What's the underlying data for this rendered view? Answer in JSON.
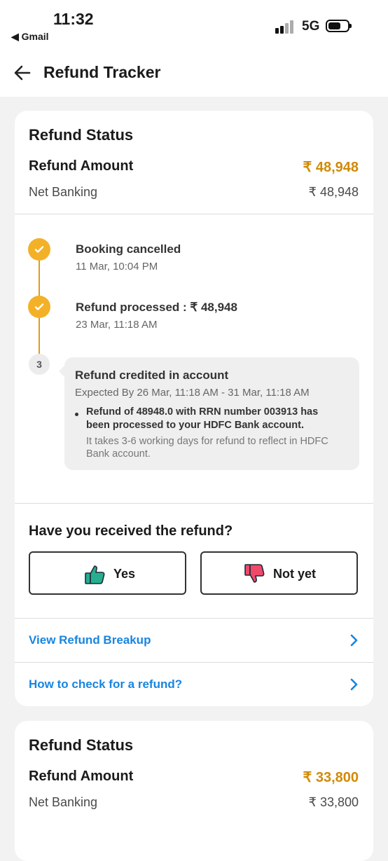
{
  "status_bar": {
    "time": "11:32",
    "back_app": "◀ Gmail",
    "network": "5G"
  },
  "app_bar": {
    "title": "Refund Tracker"
  },
  "cards": [
    {
      "heading": "Refund Status",
      "amount_label": "Refund Amount",
      "amount_value": "₹ 48,948",
      "method_label": "Net Banking",
      "method_value": "₹ 48,948",
      "steps": [
        {
          "title": "Booking cancelled",
          "subtitle": "11 Mar, 10:04 PM",
          "state": "done"
        },
        {
          "title": "Refund processed : ₹ 48,948",
          "subtitle": "23 Mar, 11:18 AM",
          "state": "done"
        },
        {
          "number": "3",
          "title": "Refund credited in account",
          "subtitle": "Expected By 26 Mar, 11:18 AM - 31 Mar, 11:18 AM",
          "note_line1": "Refund of 48948.0 with RRN number 003913 has",
          "note_line2": "been processed to your HDFC Bank account.",
          "info_line1": "It takes 3-6 working days for refund to reflect in HDFC",
          "info_line2": "Bank account.",
          "state": "pending"
        }
      ],
      "question": "Have you received the refund?",
      "yes_label": "Yes",
      "no_label": "Not yet",
      "links": [
        {
          "label": "View Refund Breakup"
        },
        {
          "label": "How to check for a refund?"
        }
      ]
    },
    {
      "heading": "Refund Status",
      "amount_label": "Refund Amount",
      "amount_value": "₹ 33,800",
      "method_label": "Net Banking",
      "method_value": "₹ 33,800"
    }
  ],
  "colors": {
    "accent": "#d18a06",
    "timeline": "#f3b128",
    "link": "#1785e0"
  },
  "icons": {
    "back": "arrow-left-icon",
    "check": "check-icon",
    "thumbs_up": "thumbs-up-icon",
    "thumbs_down": "thumbs-down-icon",
    "chevron": "chevron-right-icon"
  }
}
